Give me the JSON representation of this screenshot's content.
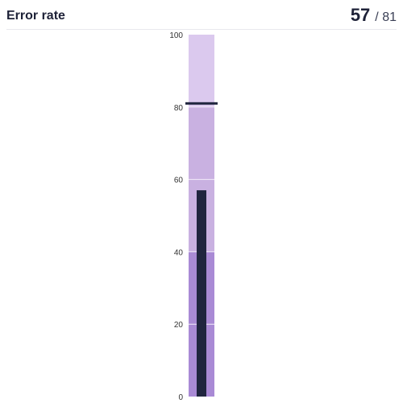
{
  "header": {
    "title": "Error rate",
    "value": "57",
    "separator": "/",
    "target": "81"
  },
  "colors": {
    "band_low": "#a98ad5",
    "band_mid": "#c9b1e1",
    "band_high": "#dbc9ee",
    "bar": "#20253f",
    "target_marker": "#20253f",
    "gridline": "#f4eefb"
  },
  "chart_data": {
    "type": "bullet",
    "orientation": "vertical",
    "title": "Error rate",
    "value": 57,
    "target": 81,
    "ylim": [
      0,
      100
    ],
    "yticks": [
      0,
      20,
      40,
      60,
      80,
      100
    ],
    "bands": [
      {
        "from": 0,
        "to": 40,
        "color": "#a98ad5"
      },
      {
        "from": 40,
        "to": 80,
        "color": "#c9b1e1"
      },
      {
        "from": 80,
        "to": 100,
        "color": "#dbc9ee"
      }
    ],
    "grid": true
  }
}
